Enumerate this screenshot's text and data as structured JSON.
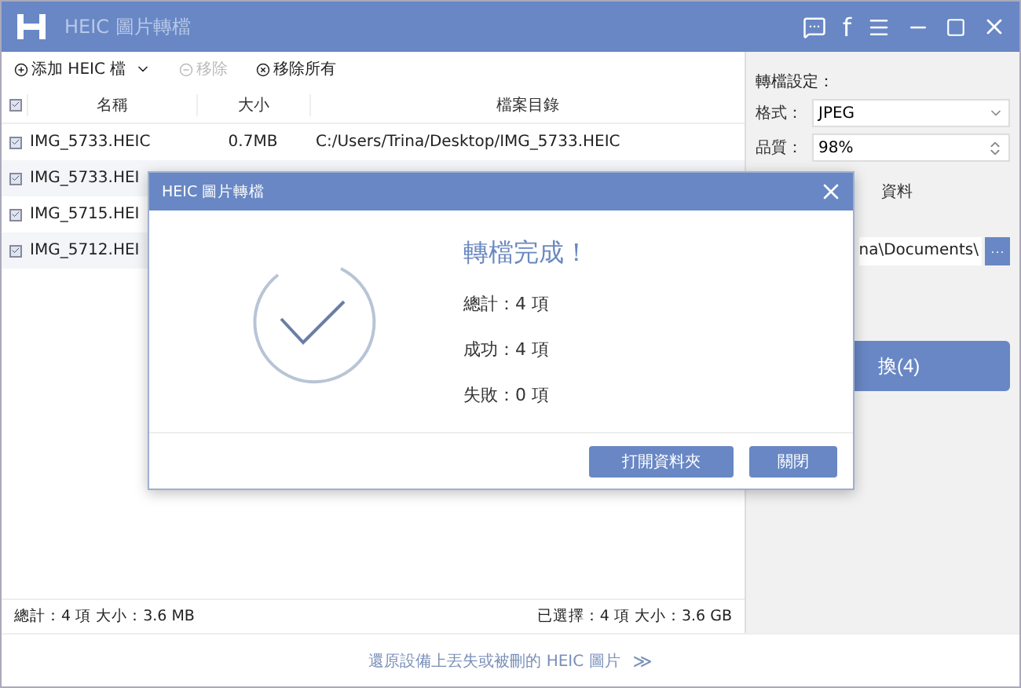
{
  "window": {
    "title": "HEIC 圖片轉檔",
    "facebook_glyph": "f"
  },
  "toolbar": [
    {
      "kind": "add",
      "label": "添加 HEIC 檔",
      "disabled": false
    },
    {
      "kind": "remove",
      "label": "移除",
      "disabled": true
    },
    {
      "kind": "clear",
      "label": "移除所有",
      "disabled": false
    }
  ],
  "table": {
    "select_all_checked": true,
    "columns": [
      "名稱",
      "大小",
      "檔案目錄"
    ],
    "rows": [
      {
        "checked": true,
        "name": "IMG_5733.HEIC",
        "size": "0.7MB",
        "path": "C:/Users/Trina/Desktop/IMG_5733.HEIC"
      },
      {
        "checked": true,
        "name": "IMG_5733.HEI"
      },
      {
        "checked": true,
        "name": "IMG_5715.HEI"
      },
      {
        "checked": true,
        "name": "IMG_5712.HEI"
      }
    ]
  },
  "status_bar": {
    "total": "總計：4 項 大小：3.6 MB",
    "selected": "已選擇：4 項 大小：3.6 GB"
  },
  "settings": {
    "title": "轉檔設定：",
    "format_label": "格式：",
    "format": "JPEG",
    "quality_label": "品質：",
    "quality": "98%",
    "keep_label": "資料",
    "folder": "na\\Documents\\",
    "browse": "···",
    "convert": "換(4)"
  },
  "footer_link": "還原設備上丟失或被刪的 HEIC 圖片",
  "footer_arrow": "≫",
  "dialog": {
    "title": "HEIC 圖片轉檔",
    "heading": "轉檔完成！",
    "stats": [
      "總計：4 項",
      "成功：4 項",
      "失敗：0 項"
    ],
    "buttons": [
      "打開資料夾",
      "關閉"
    ]
  }
}
